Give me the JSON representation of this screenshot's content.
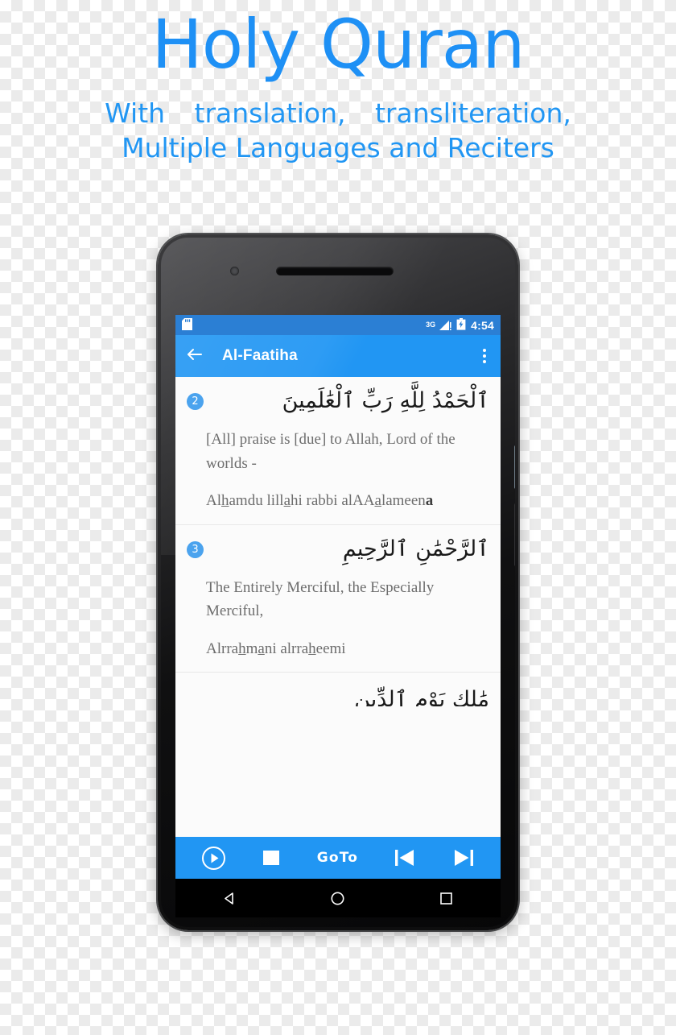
{
  "hero": {
    "title": "Holy Quran",
    "subtitle_line1": "With translation, transliteration,",
    "subtitle_line2": "Multiple Languages and Reciters",
    "title_color": "#1e90f5",
    "subtitle_color": "#2196f3"
  },
  "phone": {
    "status_bar": {
      "sd_icon": "sd-card-icon",
      "network_label": "3G",
      "signal_icon": "signal-bars-icon",
      "signal_alert": "!",
      "battery_icon": "battery-charging-icon",
      "clock": "4:54",
      "background_color": "#2b7fd4"
    },
    "app_bar": {
      "back_icon": "back-arrow-icon",
      "title": "Al-Faatiha",
      "overflow_icon": "overflow-menu-icon",
      "background_color": "#2196f3"
    },
    "verses": [
      {
        "number": "2",
        "arabic": "ٱلْحَمْدُ لِلَّهِ رَبِّ ٱلْعَٰلَمِينَ",
        "translation": "[All] praise is [due] to Allah, Lord of the worlds -",
        "transliteration_prefix": "Al",
        "transliteration_parts": [
          "h",
          "amdu lill",
          "a",
          "hi rabbi alAA",
          "a",
          "lameen"
        ],
        "transliteration_suffix": "a",
        "transliteration_plain": "Alhamdu lillahi rabbi alAAalameena"
      },
      {
        "number": "3",
        "arabic": "ٱلرَّحْمَٰنِ ٱلرَّحِيمِ",
        "translation": "The Entirely Merciful, the Especially Merciful,",
        "transliteration_prefix": "Alrra",
        "transliteration_parts": [
          "h",
          "m",
          "a",
          "ni alrra",
          "h",
          "eemi"
        ],
        "transliteration_suffix": "",
        "transliteration_plain": "Alrrahmani alrraheemi"
      }
    ],
    "verse_clipped_arabic": "مَٰلِكِ يَوْمِ ٱلدِّينِ",
    "player_bar": {
      "play_icon": "play-circle-icon",
      "stop_icon": "stop-square-icon",
      "goto_label": "GoTo",
      "previous_icon": "skip-previous-icon",
      "next_icon": "skip-next-icon",
      "background_color": "#2196f3"
    },
    "nav_bar": {
      "back_icon": "nav-back-triangle-icon",
      "home_icon": "nav-home-circle-icon",
      "recents_icon": "nav-recents-square-icon",
      "background_color": "#000000"
    }
  }
}
